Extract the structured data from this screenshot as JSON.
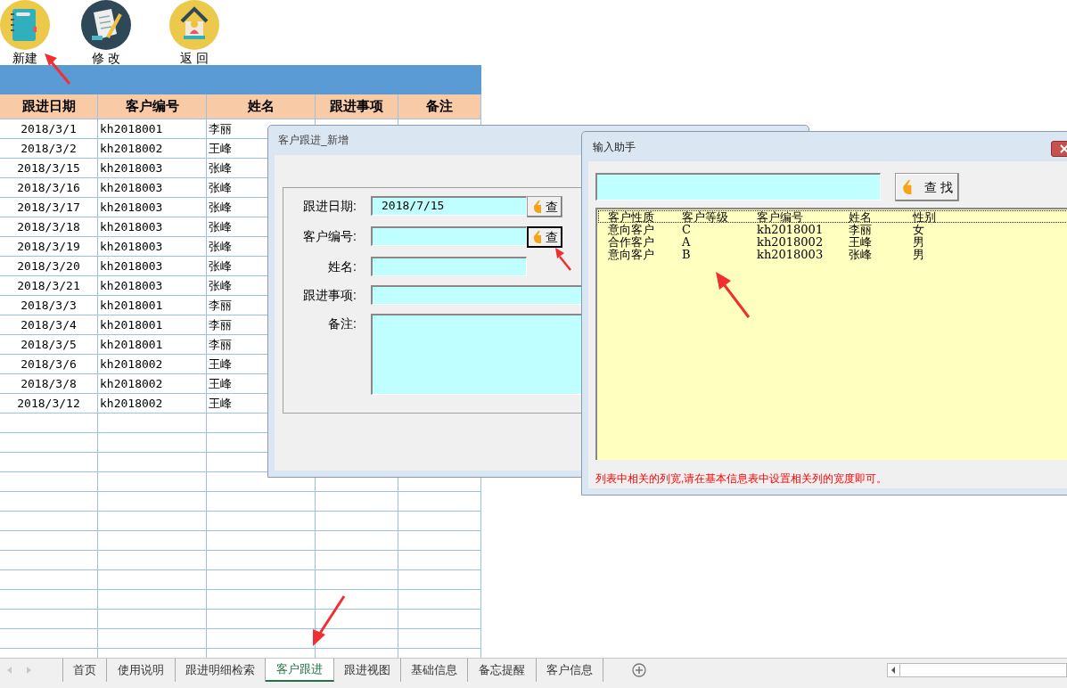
{
  "toolbar": [
    {
      "kind": "notebook",
      "label": "新建"
    },
    {
      "kind": "scroll",
      "label": "修 改"
    },
    {
      "kind": "house",
      "label": "返 回"
    }
  ],
  "table": {
    "columns": [
      "跟进日期",
      "客户编号",
      "姓名",
      "跟进事项",
      "备注"
    ],
    "rows": [
      [
        "2018/3/1",
        "kh2018001",
        "李丽"
      ],
      [
        "2018/3/2",
        "kh2018002",
        "王峰"
      ],
      [
        "2018/3/15",
        "kh2018003",
        "张峰"
      ],
      [
        "2018/3/16",
        "kh2018003",
        "张峰"
      ],
      [
        "2018/3/17",
        "kh2018003",
        "张峰"
      ],
      [
        "2018/3/18",
        "kh2018003",
        "张峰"
      ],
      [
        "2018/3/19",
        "kh2018003",
        "张峰"
      ],
      [
        "2018/3/20",
        "kh2018003",
        "张峰"
      ],
      [
        "2018/3/21",
        "kh2018003",
        "张峰"
      ],
      [
        "2018/3/3",
        "kh2018001",
        "李丽"
      ],
      [
        "2018/3/4",
        "kh2018001",
        "李丽"
      ],
      [
        "2018/3/5",
        "kh2018001",
        "李丽"
      ],
      [
        "2018/3/6",
        "kh2018002",
        "王峰"
      ],
      [
        "2018/3/8",
        "kh2018002",
        "王峰"
      ],
      [
        "2018/3/12",
        "kh2018002",
        "王峰"
      ]
    ]
  },
  "dialog_new": {
    "title": "客户跟进_新增",
    "fields": [
      {
        "kind": "lookup",
        "label": "跟进日期:",
        "value": "2018/7/15",
        "button": "查",
        "focused": false
      },
      {
        "kind": "lookup",
        "label": "客户编号:",
        "button": "查",
        "focused": true
      },
      {
        "kind": "short",
        "label": "姓名:"
      },
      {
        "kind": "wide",
        "label": "跟进事项:"
      },
      {
        "kind": "memo",
        "label": "备注:"
      }
    ]
  },
  "dialog_helper": {
    "title": "输入助手",
    "search_button": "查 找",
    "list": {
      "columns": [
        "客户性质",
        "客户等级",
        "客户编号",
        "姓名",
        "性别"
      ],
      "rows": [
        [
          "意向客户",
          "C",
          "kh2018001",
          "李丽",
          "女"
        ],
        [
          "合作客户",
          "A",
          "kh2018002",
          "王峰",
          "男"
        ],
        [
          "意向客户",
          "B",
          "kh2018003",
          "张峰",
          "男"
        ]
      ]
    },
    "hint": "列表中相关的列宽,请在基本信息表中设置相关列的宽度即可。"
  },
  "sheet_tabs": [
    {
      "label": "首页",
      "selected": false
    },
    {
      "label": "使用说明",
      "selected": false
    },
    {
      "label": "跟进明细检索",
      "selected": false
    },
    {
      "label": "客户跟进",
      "selected": true
    },
    {
      "label": "跟进视图",
      "selected": false
    },
    {
      "label": "基础信息",
      "selected": false
    },
    {
      "label": "备忘提醒",
      "selected": false
    },
    {
      "label": "客户信息",
      "selected": false
    }
  ]
}
